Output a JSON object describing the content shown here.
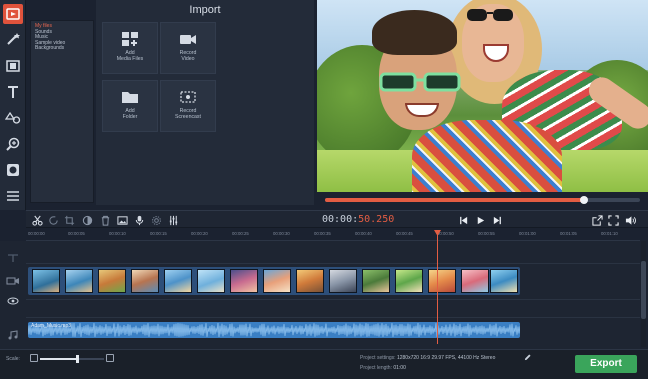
{
  "import_panel": {
    "title": "Import",
    "categories": [
      "My files",
      "Sounds",
      "Music",
      "Sample video",
      "Backgrounds"
    ],
    "tiles": [
      {
        "label": "Add\nMedia Files",
        "icon": "media-files-icon"
      },
      {
        "label": "Record\nVideo",
        "icon": "camera-icon"
      },
      {
        "label": "Add\nFolder",
        "icon": "folder-icon"
      },
      {
        "label": "Record\nScreencast",
        "icon": "screencast-icon"
      }
    ]
  },
  "toolbar": {
    "tools": [
      "import-icon",
      "magic-wand-icon",
      "transitions-icon",
      "titles-icon",
      "stickers-icon",
      "zoom-icon",
      "filters-icon",
      "more-icon"
    ],
    "active": "import-icon"
  },
  "preview": {
    "progress": 0.82
  },
  "playback": {
    "timecode_main": "00:00:",
    "timecode_sub": "50.250"
  },
  "ruler_ticks": [
    "00:00:00",
    "00:00:05",
    "00:00:10",
    "00:00:15",
    "00:00:20",
    "00:00:25",
    "00:00:30",
    "00:00:35",
    "00:00:40",
    "00:00:45",
    "00:00:50",
    "00:00:55",
    "00:01:00",
    "00:01:05",
    "00:01:10",
    "00:01:15"
  ],
  "audio": {
    "clip_name": "Adam_Music.mp3"
  },
  "bottom": {
    "scale_label": "Scale:",
    "project_settings_label": "Project settings:",
    "project_settings_value": "1280x720 16:9 29.97 FPS, 44100 Hz Stereo",
    "project_length_label": "Project length:",
    "project_length_value": "01:00",
    "export_label": "Export",
    "scale_value": 0.58
  },
  "colors": {
    "accent": "#e35d43",
    "export": "#3aa55b",
    "audio": "#3a7fc4"
  }
}
